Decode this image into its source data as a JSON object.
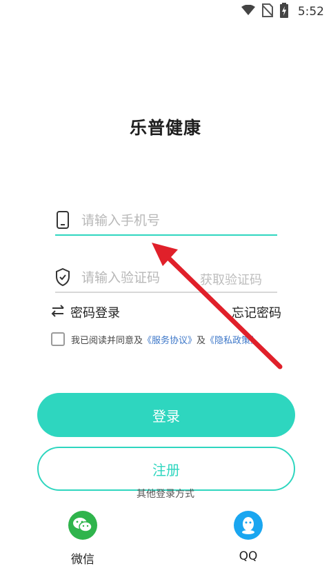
{
  "status_bar": {
    "time": "5:52"
  },
  "app": {
    "title": "乐普健康"
  },
  "phone_field": {
    "placeholder": "请输入手机号",
    "value": ""
  },
  "code_field": {
    "placeholder": "请输入验证码",
    "value": "",
    "get_code_label": "获取验证码"
  },
  "links": {
    "password_login": "密码登录",
    "forgot_password": "忘记密码"
  },
  "agreement": {
    "prefix": "我已阅读并同意及",
    "service": "《服务协议》",
    "and": "及",
    "privacy": "《隐私政策》"
  },
  "buttons": {
    "login": "登录",
    "register": "注册"
  },
  "other_login": {
    "title": "其他登录方式",
    "wechat": "微信",
    "qq": "QQ"
  },
  "colors": {
    "accent": "#2ed6bf",
    "link": "#3b76c8",
    "annotation_arrow": "#e0202a",
    "wechat": "#2fb44c",
    "qq": "#1aa6f0"
  },
  "icons": [
    "wifi-icon",
    "no-sim-icon",
    "battery-charging-icon",
    "phone-icon",
    "shield-check-icon",
    "swap-arrows-icon",
    "wechat-icon",
    "qq-icon"
  ]
}
